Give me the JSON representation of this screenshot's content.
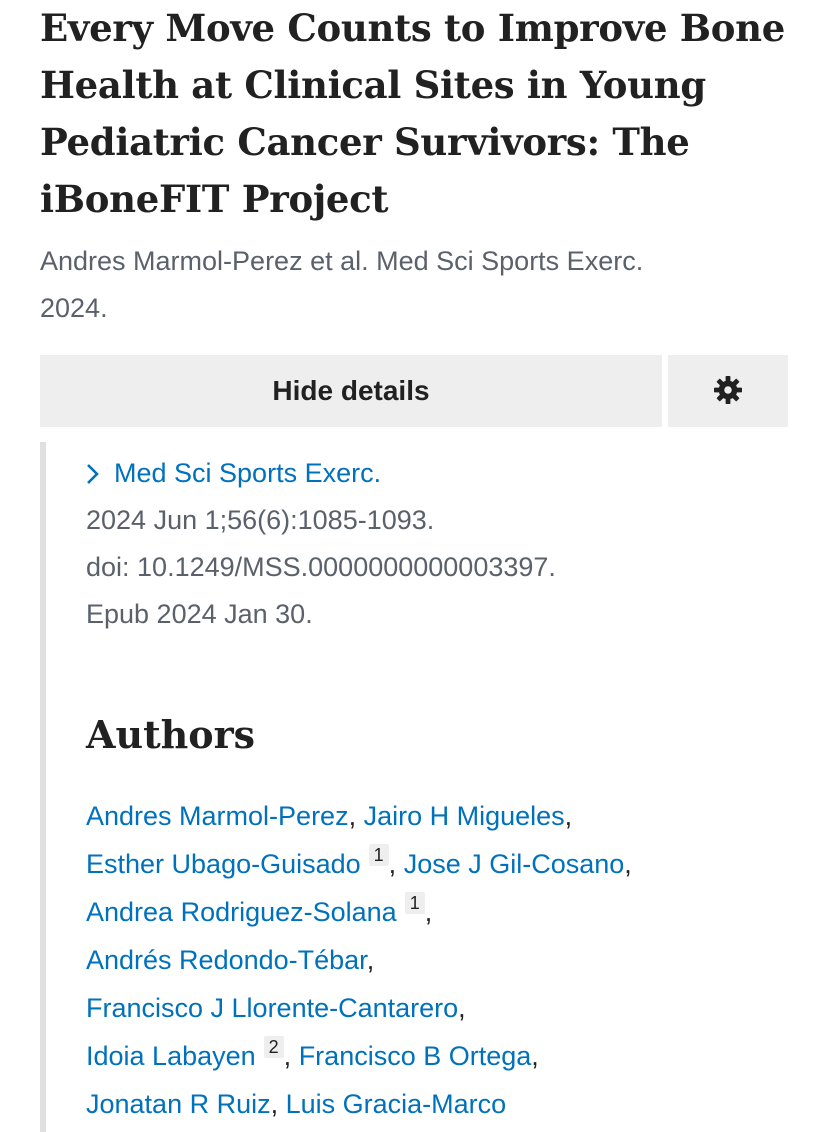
{
  "article": {
    "title": "Every Move Counts to Improve Bone Health at Clinical Sites in Young Pediatric Cancer Survivors: The iBoneFIT Project",
    "citation_line1": "Andres Marmol-Perez et al. Med Sci Sports Exerc.",
    "citation_line2": "2024."
  },
  "buttons": {
    "hide_details": "Hide details",
    "settings_icon": "gear-icon"
  },
  "details": {
    "journal_icon": "chevron-right-icon",
    "journal": "Med Sci Sports Exerc.",
    "date_pages": "2024 Jun 1;56(6):1085-1093.",
    "doi": "doi: 10.1249/MSS.0000000000003397.",
    "epub": "Epub 2024 Jan 30."
  },
  "authors": {
    "heading": "Authors",
    "list": [
      {
        "name": "Andres Marmol-Perez",
        "aff": ""
      },
      {
        "name": "Jairo H Migueles",
        "aff": ""
      },
      {
        "name": "Esther Ubago-Guisado",
        "aff": "1"
      },
      {
        "name": "Jose J Gil-Cosano",
        "aff": ""
      },
      {
        "name": "Andrea Rodriguez-Solana",
        "aff": "1"
      },
      {
        "name": "Andrés Redondo-Tébar",
        "aff": ""
      },
      {
        "name": "Francisco J Llorente-Cantarero",
        "aff": ""
      },
      {
        "name": "Idoia Labayen",
        "aff": "2"
      },
      {
        "name": "Francisco B Ortega",
        "aff": ""
      },
      {
        "name": "Jonatan R Ruiz",
        "aff": ""
      },
      {
        "name": "Luis Gracia-Marco",
        "aff": ""
      }
    ]
  },
  "colors": {
    "link": "#0071bc",
    "text": "#212121",
    "muted": "#5b616b",
    "button_bg": "#eeeeee"
  }
}
